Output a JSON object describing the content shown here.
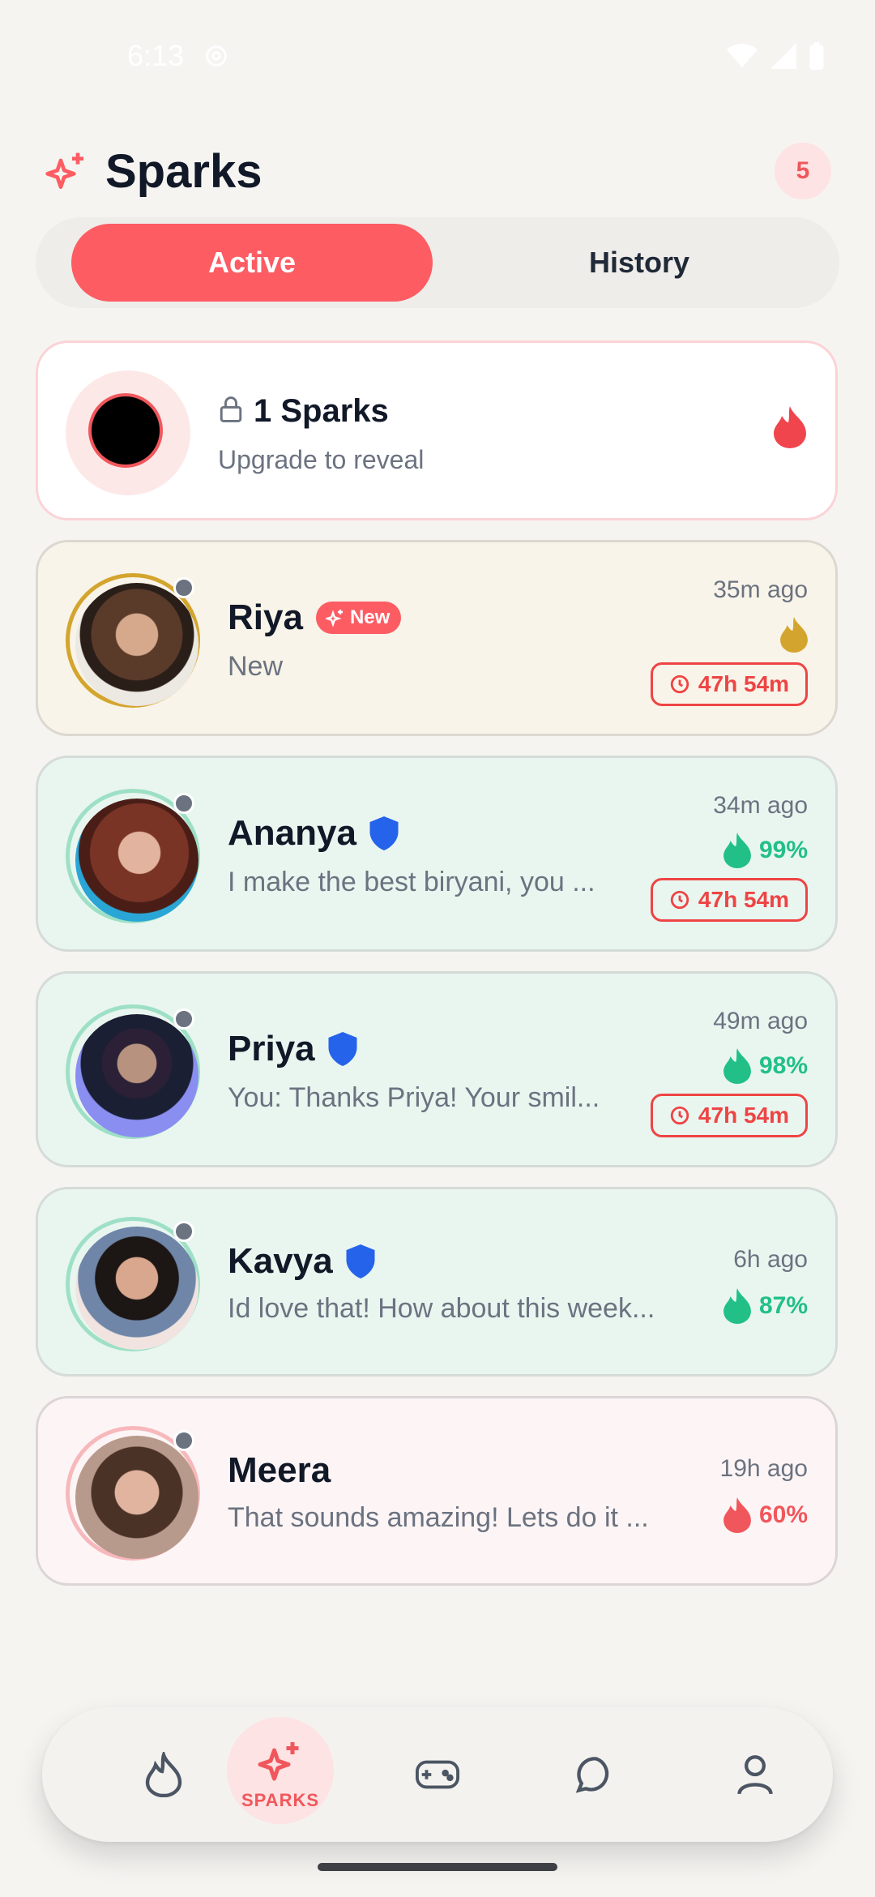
{
  "status_bar": {
    "time": "6:13"
  },
  "header": {
    "title": "Sparks",
    "count_badge": "5"
  },
  "tabs": {
    "active_label": "Active",
    "history_label": "History"
  },
  "locked_card": {
    "title": "1 Sparks",
    "subtitle": "Upgrade to reveal"
  },
  "conversations": [
    {
      "name": "Riya",
      "badge": "New",
      "preview": "New",
      "time": "35m ago",
      "match": "",
      "timer": "47h 54m",
      "theme": "gold"
    },
    {
      "name": "Ananya",
      "verified": true,
      "preview": "I make the best biryani, you ...",
      "time": "34m ago",
      "match": "99%",
      "timer": "47h 54m",
      "theme": "green"
    },
    {
      "name": "Priya",
      "verified": true,
      "preview": "You: Thanks Priya! Your smil...",
      "time": "49m ago",
      "match": "98%",
      "timer": "47h 54m",
      "theme": "green"
    },
    {
      "name": "Kavya",
      "verified": true,
      "preview": "Id love that! How about this week...",
      "time": "6h ago",
      "match": "87%",
      "theme": "green"
    },
    {
      "name": "Meera",
      "verified": false,
      "preview": "That sounds amazing! Lets do it ...",
      "time": "19h ago",
      "match": "60%",
      "theme": "pink"
    }
  ],
  "colors": {
    "accent": "#fd5c63",
    "gold": "#d4a52e",
    "green": "#22c087",
    "verified": "#2563eb",
    "timer": "#ef4444"
  },
  "nav": {
    "items": [
      {
        "icon": "flame-icon",
        "label": ""
      },
      {
        "icon": "sparkles-icon",
        "label": "SPARKS"
      },
      {
        "icon": "gamepad-icon",
        "label": ""
      },
      {
        "icon": "chat-icon",
        "label": ""
      },
      {
        "icon": "profile-icon",
        "label": ""
      }
    ]
  }
}
